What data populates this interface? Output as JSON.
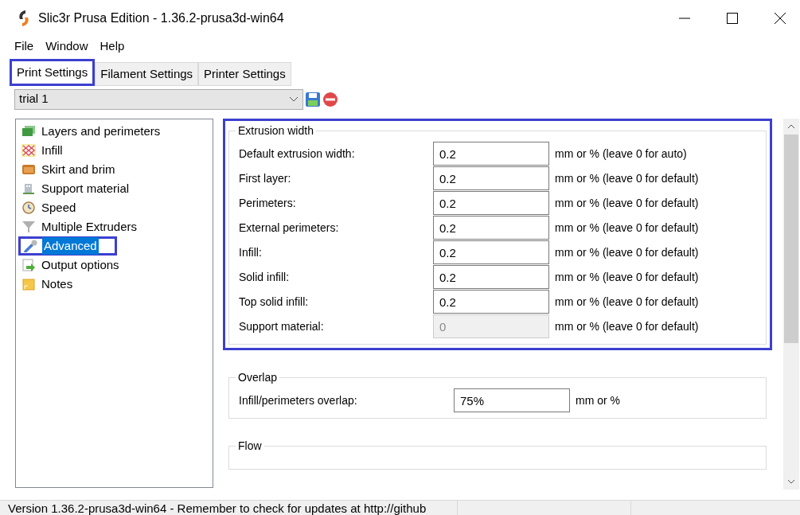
{
  "window": {
    "title": "Slic3r Prusa Edition - 1.36.2-prusa3d-win64"
  },
  "menu": [
    "File",
    "Window",
    "Help"
  ],
  "tabs": [
    {
      "label": "Print Settings",
      "selected": true
    },
    {
      "label": "Filament Settings",
      "selected": false
    },
    {
      "label": "Printer Settings",
      "selected": false
    }
  ],
  "preset": {
    "value": "trial 1"
  },
  "sidebar": {
    "items": [
      {
        "label": "Layers and perimeters",
        "kind": "layers",
        "selected": false
      },
      {
        "label": "Infill",
        "kind": "infill",
        "selected": false
      },
      {
        "label": "Skirt and brim",
        "kind": "skirt",
        "selected": false
      },
      {
        "label": "Support material",
        "kind": "support",
        "selected": false
      },
      {
        "label": "Speed",
        "kind": "speed",
        "selected": false
      },
      {
        "label": "Multiple Extruders",
        "kind": "funnel",
        "selected": false
      },
      {
        "label": "Advanced",
        "kind": "wrench",
        "selected": true
      },
      {
        "label": "Output options",
        "kind": "output",
        "selected": false
      },
      {
        "label": "Notes",
        "kind": "notes",
        "selected": false
      }
    ]
  },
  "groups": [
    {
      "title": "Extrusion width",
      "highlighted": true,
      "rows": [
        {
          "label": "Default extrusion width:",
          "value": "0.2",
          "unit": "mm or % (leave 0 for auto)",
          "disabled": false
        },
        {
          "label": "First layer:",
          "value": "0.2",
          "unit": "mm or % (leave 0 for default)",
          "disabled": false
        },
        {
          "label": "Perimeters:",
          "value": "0.2",
          "unit": "mm or % (leave 0 for default)",
          "disabled": false
        },
        {
          "label": "External perimeters:",
          "value": "0.2",
          "unit": "mm or % (leave 0 for default)",
          "disabled": false
        },
        {
          "label": "Infill:",
          "value": "0.2",
          "unit": "mm or % (leave 0 for default)",
          "disabled": false
        },
        {
          "label": "Solid infill:",
          "value": "0.2",
          "unit": "mm or % (leave 0 for default)",
          "disabled": false
        },
        {
          "label": "Top solid infill:",
          "value": "0.2",
          "unit": "mm or % (leave 0 for default)",
          "disabled": false
        },
        {
          "label": "Support material:",
          "value": "0",
          "unit": "mm or % (leave 0 for default)",
          "disabled": true
        }
      ]
    },
    {
      "title": "Overlap",
      "highlighted": false,
      "rows": [
        {
          "label": "Infill/perimeters overlap:",
          "value": "75%",
          "unit": "mm or %",
          "disabled": false
        }
      ]
    },
    {
      "title": "Flow",
      "highlighted": false
    }
  ],
  "status_bar": {
    "text": "Version 1.36.2-prusa3d-win64 - Remember to check for updates at http://github"
  }
}
